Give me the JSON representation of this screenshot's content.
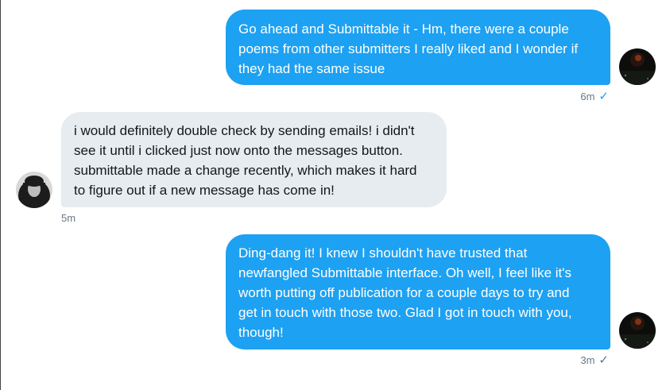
{
  "conversation": {
    "messages": [
      {
        "direction": "outgoing",
        "lines": [
          "Go ahead and Submittable it - Hm, there were a couple",
          "poems from other submitters I really liked and I wonder if",
          "they had the same issue"
        ],
        "time": "6m",
        "status_icon": "check-icon",
        "status_color": "#1da1f2"
      },
      {
        "direction": "incoming",
        "lines": [
          "i would definitely double check by sending emails! i didn't",
          "see it until i clicked just now onto the messages button.",
          "submittable made a change recently, which makes it hard",
          "to figure out if a new message has come in!"
        ],
        "time": "5m"
      },
      {
        "direction": "outgoing",
        "lines": [
          "Ding-dang it! I knew I shouldn't have trusted that",
          "newfangled Submittable interface. Oh well, I feel like it's",
          "worth putting off publication for a couple days to try and",
          "get in touch with those two. Glad I got in touch with you,",
          "though!"
        ],
        "time": "3m",
        "status_icon": "check-icon",
        "status_color": "#657786"
      }
    ]
  },
  "colors": {
    "outgoing_bubble": "#1da1f2",
    "incoming_bubble": "#e6ecf0",
    "meta_text": "#657786"
  }
}
